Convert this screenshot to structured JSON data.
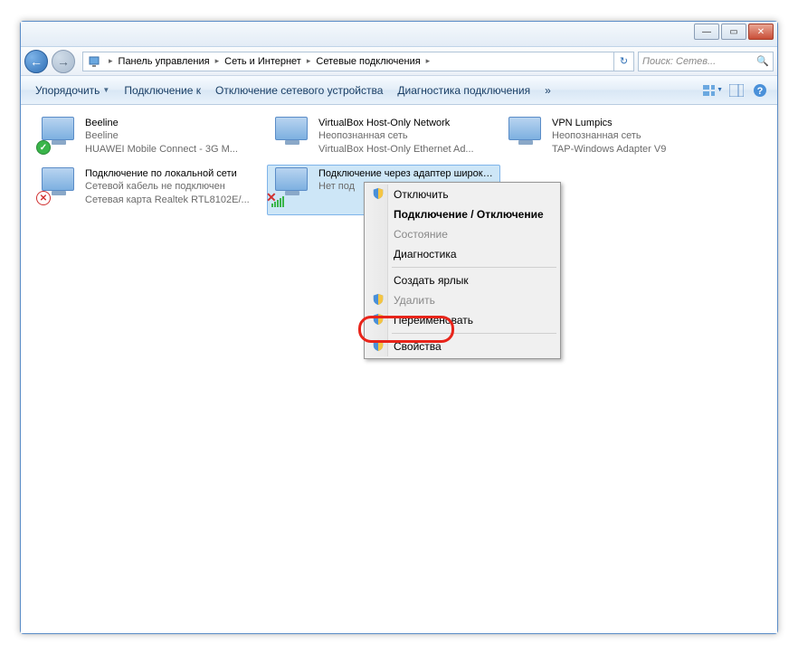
{
  "titlebar": {
    "min": "—",
    "max": "▭",
    "close": "✕"
  },
  "breadcrumb": {
    "items": [
      "Панель управления",
      "Сеть и Интернет",
      "Сетевые подключения"
    ]
  },
  "search": {
    "placeholder": "Поиск: Сетев..."
  },
  "toolbar": {
    "organize": "Упорядочить",
    "connect": "Подключение к",
    "disable": "Отключение сетевого устройства",
    "diagnose": "Диагностика подключения",
    "more": "»"
  },
  "connections": [
    {
      "name": "Beeline",
      "status": "Beeline",
      "adapter": "HUAWEI Mobile Connect - 3G M...",
      "badge": "ok"
    },
    {
      "name": "VirtualBox Host-Only Network",
      "status": "Неопознанная сеть",
      "adapter": "VirtualBox Host-Only Ethernet Ad...",
      "badge": "none"
    },
    {
      "name": "VPN Lumpics",
      "status": "Неопознанная сеть",
      "adapter": "TAP-Windows Adapter V9",
      "badge": "none"
    },
    {
      "name": "Подключение по локальной сети",
      "status": "Сетевой кабель не подключен",
      "adapter": "Сетевая карта Realtek RTL8102E/...",
      "badge": "x"
    },
    {
      "name": "Подключение через адаптер широкополосной мобильной с...",
      "status": "Нет под",
      "adapter": "",
      "badge": "signal-x",
      "selected": true
    }
  ],
  "context_menu": {
    "items": [
      {
        "label": "Отключить",
        "shield": true
      },
      {
        "label": "Подключение / Отключение",
        "bold": true
      },
      {
        "label": "Состояние",
        "disabled": true
      },
      {
        "label": "Диагностика"
      },
      {
        "sep": true
      },
      {
        "label": "Создать ярлык"
      },
      {
        "label": "Удалить",
        "shield": true,
        "disabled": true
      },
      {
        "label": "Переименовать",
        "shield": true
      },
      {
        "sep": true
      },
      {
        "label": "Свойства",
        "shield": true
      }
    ]
  }
}
